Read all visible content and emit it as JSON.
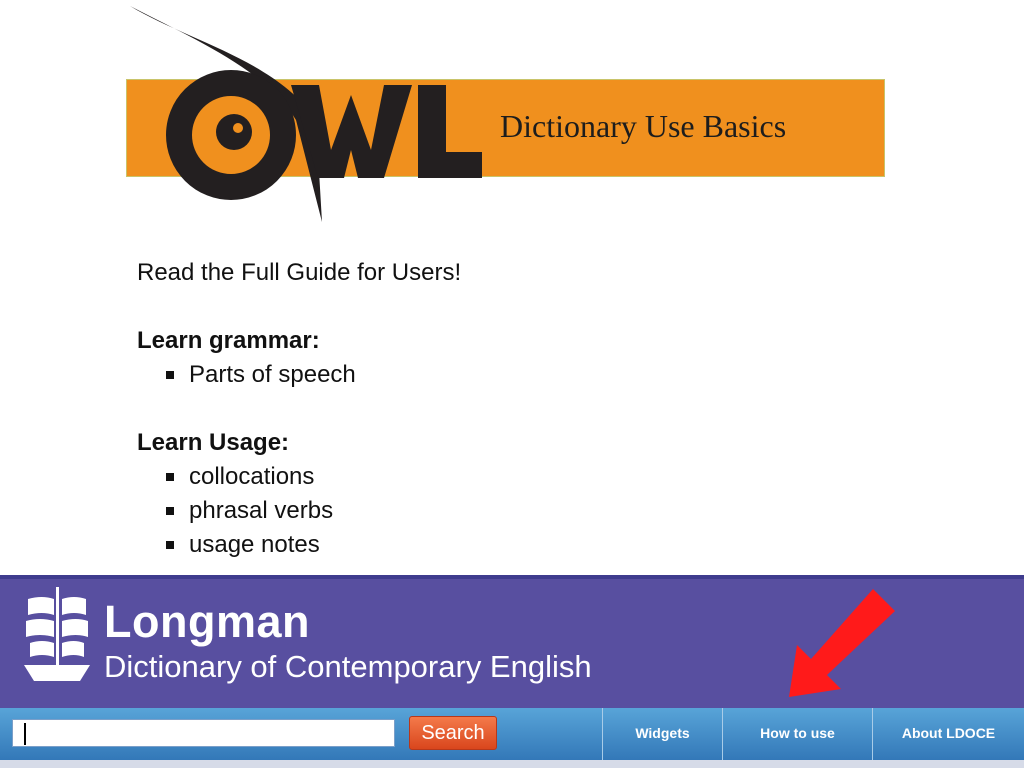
{
  "banner": {
    "logo_text": "OWL",
    "title": "Dictionary Use Basics",
    "colors": {
      "background": "#f0901e",
      "logo": "#231f20"
    }
  },
  "content": {
    "intro": "Read the Full Guide for Users!",
    "sections": [
      {
        "heading": "Learn grammar:",
        "items": [
          "Parts of speech"
        ]
      },
      {
        "heading": "Learn Usage:",
        "items": [
          "collocations",
          "phrasal verbs",
          "usage notes"
        ]
      }
    ]
  },
  "longman": {
    "brand": "Longman",
    "subtitle": "Dictionary of Contemporary English",
    "logo_icon": "ship-icon",
    "search": {
      "value": "",
      "placeholder": "",
      "button_label": "Search"
    },
    "nav": [
      "Widgets",
      "How to use",
      "About LDOCE"
    ],
    "pointer_icon": "red-arrow-icon",
    "colors": {
      "header": "#584fa0",
      "toolbar": "#3f8cc8",
      "search_button": "#e4572b",
      "arrow": "#ff1a1a"
    }
  }
}
